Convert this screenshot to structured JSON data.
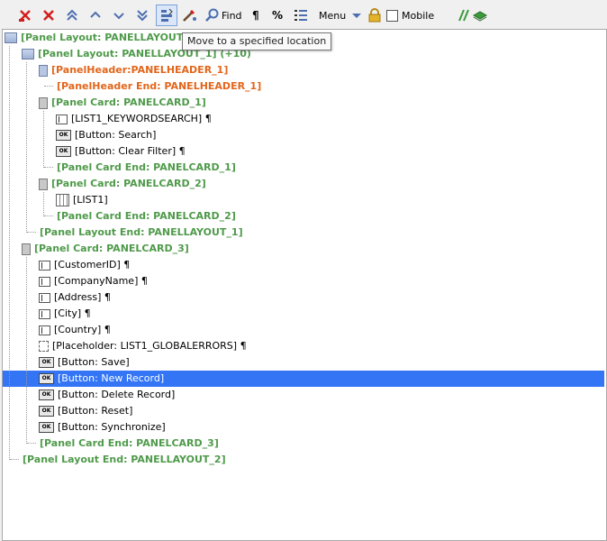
{
  "toolbar": {
    "find_label": "Find",
    "pilcrow_label": "¶",
    "percent_label": "%",
    "menu_label": "Menu",
    "mobile_label": "Mobile",
    "mobile_checked": false
  },
  "tooltip": "Move to a specified location",
  "tree": {
    "nodes": [
      {
        "text": "[Panel Layout: PANELLAYOUT_2]",
        "depth": 0,
        "icon": "panel-layout-icon",
        "style": "green"
      },
      {
        "text": "[Panel Layout: PANELLAYOUT_1] (+10)",
        "depth": 1,
        "icon": "panel-layout-icon",
        "style": "green"
      },
      {
        "text": "[PanelHeader:PANELHEADER_1]",
        "depth": 2,
        "icon": "panel-header-icon",
        "style": "orange"
      },
      {
        "text": "[PanelHeader End: PANELHEADER_1]",
        "depth": 2,
        "icon": "",
        "style": "orange"
      },
      {
        "text": "[Panel Card: PANELCARD_1]",
        "depth": 2,
        "icon": "panel-card-icon",
        "style": "green"
      },
      {
        "text": "[LIST1_KEYWORDSEARCH] ¶",
        "depth": 3,
        "icon": "field-icon",
        "style": "black"
      },
      {
        "text": "[Button: Search]",
        "depth": 3,
        "icon": "ok-button-icon",
        "style": "black"
      },
      {
        "text": "[Button: Clear Filter] ¶",
        "depth": 3,
        "icon": "ok-button-icon",
        "style": "black"
      },
      {
        "text": "[Panel Card End: PANELCARD_1]",
        "depth": 2,
        "icon": "",
        "style": "green"
      },
      {
        "text": "[Panel Card: PANELCARD_2]",
        "depth": 2,
        "icon": "panel-card-icon",
        "style": "green"
      },
      {
        "text": "[LIST1]",
        "depth": 3,
        "icon": "grid-icon",
        "style": "black"
      },
      {
        "text": "[Panel Card End: PANELCARD_2]",
        "depth": 2,
        "icon": "",
        "style": "green"
      },
      {
        "text": "[Panel Layout End: PANELLAYOUT_1]",
        "depth": 1,
        "icon": "",
        "style": "green"
      },
      {
        "text": "[Panel Card: PANELCARD_3]",
        "depth": 1,
        "icon": "panel-card-icon",
        "style": "green"
      },
      {
        "text": "[CustomerID] ¶",
        "depth": 2,
        "icon": "field-icon",
        "style": "black"
      },
      {
        "text": "[CompanyName] ¶",
        "depth": 2,
        "icon": "field-icon",
        "style": "black"
      },
      {
        "text": "[Address] ¶",
        "depth": 2,
        "icon": "field-icon",
        "style": "black"
      },
      {
        "text": "[City] ¶",
        "depth": 2,
        "icon": "field-icon",
        "style": "black"
      },
      {
        "text": "[Country] ¶",
        "depth": 2,
        "icon": "field-icon",
        "style": "black"
      },
      {
        "text": "[Placeholder: LIST1_GLOBALERRORS] ¶",
        "depth": 2,
        "icon": "placeholder-icon",
        "style": "black"
      },
      {
        "text": "[Button: Save]",
        "depth": 2,
        "icon": "ok-button-icon",
        "style": "black"
      },
      {
        "text": "[Button: New Record]",
        "depth": 2,
        "icon": "ok-button-icon",
        "style": "black",
        "selected": true
      },
      {
        "text": "[Button: Delete Record]",
        "depth": 2,
        "icon": "ok-button-icon",
        "style": "black"
      },
      {
        "text": "[Button: Reset]",
        "depth": 2,
        "icon": "ok-button-icon",
        "style": "black"
      },
      {
        "text": "[Button: Synchronize]",
        "depth": 2,
        "icon": "ok-button-icon",
        "style": "black"
      },
      {
        "text": "[Panel Card End: PANELCARD_3]",
        "depth": 1,
        "icon": "",
        "style": "green"
      },
      {
        "text": "[Panel Layout End: PANELLAYOUT_2]",
        "depth": 0,
        "icon": "",
        "style": "green"
      }
    ]
  },
  "colors": {
    "selection": "#3375f5",
    "green_text": "#4f9a4a",
    "orange_text": "#e2661b"
  }
}
